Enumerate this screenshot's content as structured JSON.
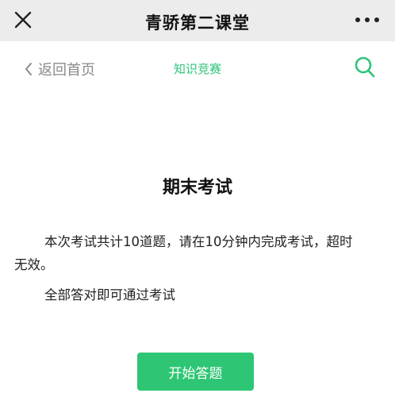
{
  "app": {
    "title": "青骄第二课堂"
  },
  "nav": {
    "back_label": "返回首页",
    "title": "知识竞赛"
  },
  "exam": {
    "title": "期末考试",
    "description": "本次考试共计10道题，请在10分钟内完成考试，超时无效。",
    "note": "全部答对即可通过考试",
    "start_label": "开始答题"
  },
  "colors": {
    "accent": "#2fc37a",
    "button": "#2ec675",
    "titlebar_bg": "#ececec"
  },
  "icons": {
    "close": "close-icon",
    "more": "more-dots-icon",
    "back": "chevron-left-icon",
    "search": "search-icon"
  }
}
